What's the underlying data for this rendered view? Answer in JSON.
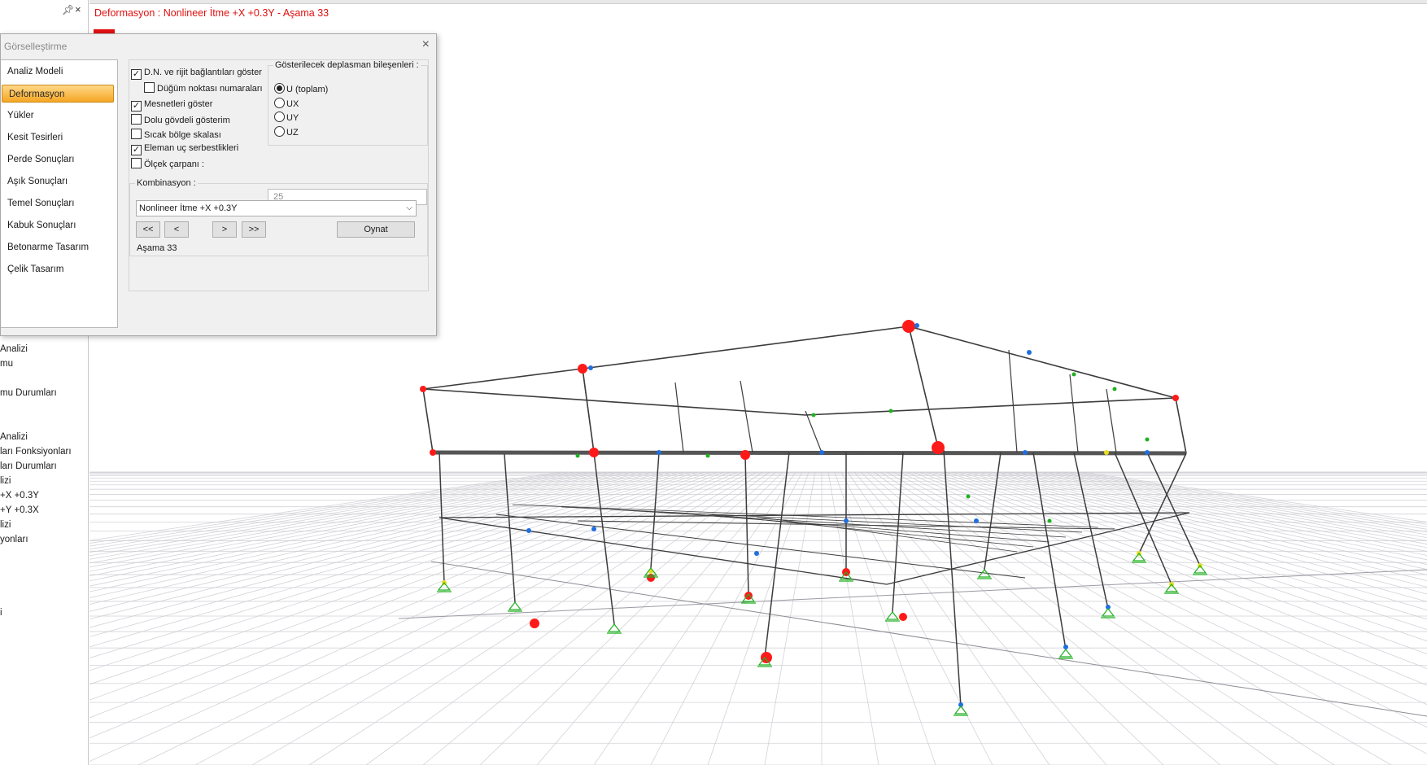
{
  "left_panel": {
    "pin_icon": "pin-icon",
    "close_icon": "close-icon",
    "tree_items": [
      " Analizi",
      "mu",
      "mu Durumları",
      " Analizi",
      "ları Fonksiyonları",
      "ları Durumları",
      "lizi",
      "+X +0.3Y",
      "+Y +0.3X",
      "lizi",
      "yonları",
      "i"
    ]
  },
  "viewport": {
    "title": "Deformasyon : Nonlineer İtme +X +0.3Y  -  Aşama 33"
  },
  "dialog": {
    "title": "Görselleştirme",
    "close_label": "×",
    "nav_items": [
      "Analiz Modeli",
      "Deformasyon",
      "Yükler",
      "Kesit Tesirleri",
      "Perde Sonuçları",
      "Aşık Sonuçları",
      "Temel Sonuçları",
      "Kabuk Sonuçları",
      "Betonarme Tasarım",
      "Çelik Tasarım"
    ],
    "selected_nav": "Deformasyon",
    "options": {
      "show_dn_rigid": {
        "label": "D.N. ve rijit bağlantıları göster",
        "checked": true
      },
      "node_numbers": {
        "label": "Düğüm noktası numaraları",
        "checked": false
      },
      "show_supports": {
        "label": "Mesnetleri göster",
        "checked": true
      },
      "solid_display": {
        "label": "Dolu gövdeli gösterim",
        "checked": false
      },
      "heat_scale": {
        "label": "Sıcak bölge skalası",
        "checked": false
      },
      "end_releases": {
        "label": "Eleman uç serbestlikleri",
        "checked": true
      },
      "scale_factor": {
        "label": "Ölçek çarpanı :",
        "checked": false,
        "value": "25"
      }
    },
    "displacement_group": {
      "legend": "Gösterilecek deplasman bileşenleri :",
      "options": [
        "U (toplam)",
        "UX",
        "UY",
        "UZ"
      ],
      "selected": "U (toplam)"
    },
    "combination_group": {
      "legend": "Kombinasyon :",
      "selected_value": "Nonlineer İtme +X +0.3Y",
      "btn_first": "<<",
      "btn_prev": "<",
      "btn_next": ">",
      "btn_last": ">>",
      "btn_play": "Oynat",
      "stage_label": "Aşama 33"
    }
  },
  "colors": {
    "title_red": "#e01010",
    "selection_orange": "#f5a623",
    "frame_dark": "#3c3c3c",
    "plastic_hinge_red": "#ff1a1a",
    "node_blue": "#1f6fe0",
    "node_green": "#20b020",
    "node_yellow": "#e8e020",
    "grid_gray": "#c8c8d0"
  }
}
